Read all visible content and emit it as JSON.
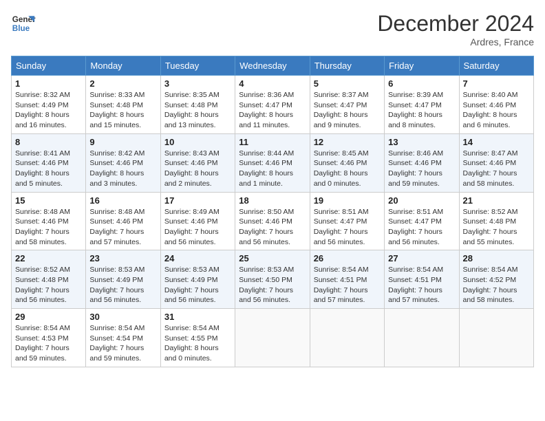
{
  "header": {
    "logo_line1": "General",
    "logo_line2": "Blue",
    "month_title": "December 2024",
    "location": "Ardres, France"
  },
  "days_of_week": [
    "Sunday",
    "Monday",
    "Tuesday",
    "Wednesday",
    "Thursday",
    "Friday",
    "Saturday"
  ],
  "weeks": [
    [
      {
        "day": "1",
        "info": "Sunrise: 8:32 AM\nSunset: 4:49 PM\nDaylight: 8 hours\nand 16 minutes."
      },
      {
        "day": "2",
        "info": "Sunrise: 8:33 AM\nSunset: 4:48 PM\nDaylight: 8 hours\nand 15 minutes."
      },
      {
        "day": "3",
        "info": "Sunrise: 8:35 AM\nSunset: 4:48 PM\nDaylight: 8 hours\nand 13 minutes."
      },
      {
        "day": "4",
        "info": "Sunrise: 8:36 AM\nSunset: 4:47 PM\nDaylight: 8 hours\nand 11 minutes."
      },
      {
        "day": "5",
        "info": "Sunrise: 8:37 AM\nSunset: 4:47 PM\nDaylight: 8 hours\nand 9 minutes."
      },
      {
        "day": "6",
        "info": "Sunrise: 8:39 AM\nSunset: 4:47 PM\nDaylight: 8 hours\nand 8 minutes."
      },
      {
        "day": "7",
        "info": "Sunrise: 8:40 AM\nSunset: 4:46 PM\nDaylight: 8 hours\nand 6 minutes."
      }
    ],
    [
      {
        "day": "8",
        "info": "Sunrise: 8:41 AM\nSunset: 4:46 PM\nDaylight: 8 hours\nand 5 minutes."
      },
      {
        "day": "9",
        "info": "Sunrise: 8:42 AM\nSunset: 4:46 PM\nDaylight: 8 hours\nand 3 minutes."
      },
      {
        "day": "10",
        "info": "Sunrise: 8:43 AM\nSunset: 4:46 PM\nDaylight: 8 hours\nand 2 minutes."
      },
      {
        "day": "11",
        "info": "Sunrise: 8:44 AM\nSunset: 4:46 PM\nDaylight: 8 hours\nand 1 minute."
      },
      {
        "day": "12",
        "info": "Sunrise: 8:45 AM\nSunset: 4:46 PM\nDaylight: 8 hours\nand 0 minutes."
      },
      {
        "day": "13",
        "info": "Sunrise: 8:46 AM\nSunset: 4:46 PM\nDaylight: 7 hours\nand 59 minutes."
      },
      {
        "day": "14",
        "info": "Sunrise: 8:47 AM\nSunset: 4:46 PM\nDaylight: 7 hours\nand 58 minutes."
      }
    ],
    [
      {
        "day": "15",
        "info": "Sunrise: 8:48 AM\nSunset: 4:46 PM\nDaylight: 7 hours\nand 58 minutes."
      },
      {
        "day": "16",
        "info": "Sunrise: 8:48 AM\nSunset: 4:46 PM\nDaylight: 7 hours\nand 57 minutes."
      },
      {
        "day": "17",
        "info": "Sunrise: 8:49 AM\nSunset: 4:46 PM\nDaylight: 7 hours\nand 56 minutes."
      },
      {
        "day": "18",
        "info": "Sunrise: 8:50 AM\nSunset: 4:46 PM\nDaylight: 7 hours\nand 56 minutes."
      },
      {
        "day": "19",
        "info": "Sunrise: 8:51 AM\nSunset: 4:47 PM\nDaylight: 7 hours\nand 56 minutes."
      },
      {
        "day": "20",
        "info": "Sunrise: 8:51 AM\nSunset: 4:47 PM\nDaylight: 7 hours\nand 56 minutes."
      },
      {
        "day": "21",
        "info": "Sunrise: 8:52 AM\nSunset: 4:48 PM\nDaylight: 7 hours\nand 55 minutes."
      }
    ],
    [
      {
        "day": "22",
        "info": "Sunrise: 8:52 AM\nSunset: 4:48 PM\nDaylight: 7 hours\nand 56 minutes."
      },
      {
        "day": "23",
        "info": "Sunrise: 8:53 AM\nSunset: 4:49 PM\nDaylight: 7 hours\nand 56 minutes."
      },
      {
        "day": "24",
        "info": "Sunrise: 8:53 AM\nSunset: 4:49 PM\nDaylight: 7 hours\nand 56 minutes."
      },
      {
        "day": "25",
        "info": "Sunrise: 8:53 AM\nSunset: 4:50 PM\nDaylight: 7 hours\nand 56 minutes."
      },
      {
        "day": "26",
        "info": "Sunrise: 8:54 AM\nSunset: 4:51 PM\nDaylight: 7 hours\nand 57 minutes."
      },
      {
        "day": "27",
        "info": "Sunrise: 8:54 AM\nSunset: 4:51 PM\nDaylight: 7 hours\nand 57 minutes."
      },
      {
        "day": "28",
        "info": "Sunrise: 8:54 AM\nSunset: 4:52 PM\nDaylight: 7 hours\nand 58 minutes."
      }
    ],
    [
      {
        "day": "29",
        "info": "Sunrise: 8:54 AM\nSunset: 4:53 PM\nDaylight: 7 hours\nand 59 minutes."
      },
      {
        "day": "30",
        "info": "Sunrise: 8:54 AM\nSunset: 4:54 PM\nDaylight: 7 hours\nand 59 minutes."
      },
      {
        "day": "31",
        "info": "Sunrise: 8:54 AM\nSunset: 4:55 PM\nDaylight: 8 hours\nand 0 minutes."
      },
      {
        "day": "",
        "info": ""
      },
      {
        "day": "",
        "info": ""
      },
      {
        "day": "",
        "info": ""
      },
      {
        "day": "",
        "info": ""
      }
    ]
  ]
}
